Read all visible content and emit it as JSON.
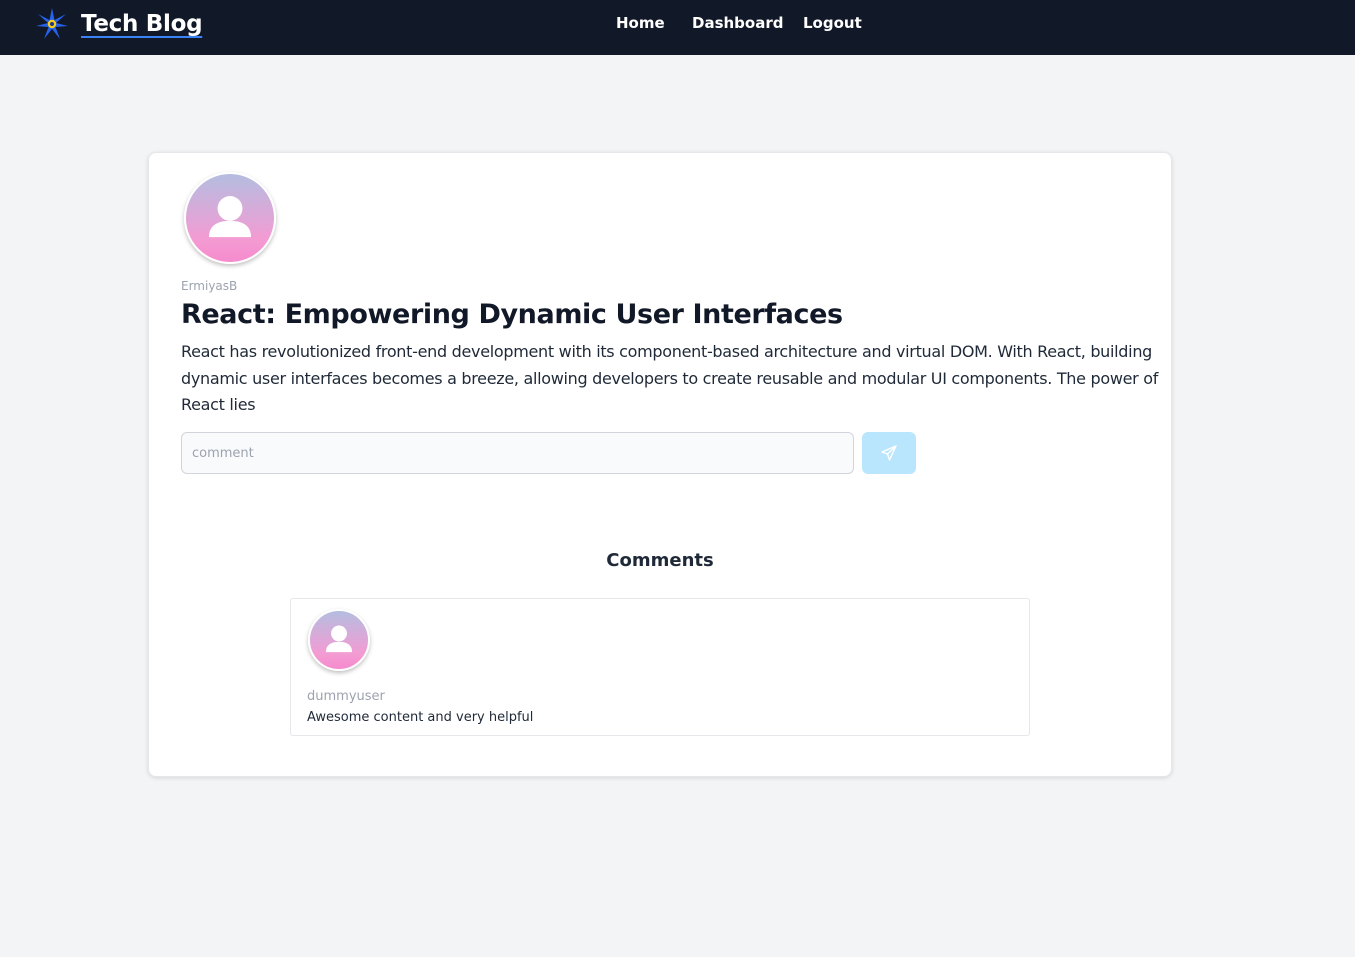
{
  "navbar": {
    "brand": "Tech Blog",
    "brand_icon": "star-logo-icon",
    "links": [
      "Home",
      "Dashboard",
      "Logout"
    ]
  },
  "post": {
    "author": "ErmiyasB",
    "title": "React: Empowering Dynamic User Interfaces",
    "body": "React has revolutionized front-end development with its component-based architecture and virtual DOM. With React, building dynamic user interfaces becomes a breeze, allowing developers to create reusable and modular UI components. The power of React lies",
    "avatar_icon": "user-avatar-icon"
  },
  "comment_form": {
    "placeholder": "comment",
    "value": "",
    "send_icon": "paper-plane-icon"
  },
  "comments": {
    "heading": "Comments",
    "items": [
      {
        "user": "dummyuser",
        "text": "Awesome content and very helpful"
      }
    ]
  },
  "colors": {
    "navbar_bg": "#111827",
    "page_bg": "#f3f4f6",
    "send_button_bg": "#bae6fd",
    "brand_underline": "#3b82f6"
  }
}
